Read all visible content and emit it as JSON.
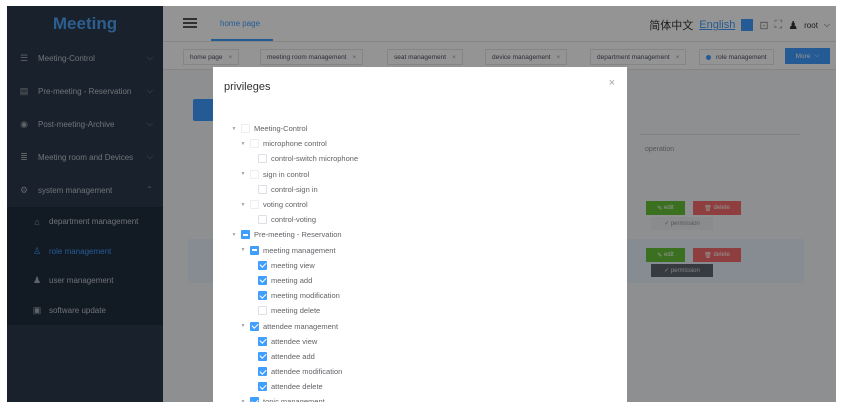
{
  "app": {
    "title": "Meeting",
    "colors": {
      "sidebar_bg": "#2b3a4d",
      "accent": "#409eff",
      "edit_green": "#67c23a",
      "delete_red": "#f56c6c"
    }
  },
  "sidebar": {
    "items": [
      {
        "label": "Meeting-Control",
        "icon": "sliders-icon",
        "expanded": false
      },
      {
        "label": "Pre-meeting - Reservation",
        "icon": "calendar-icon",
        "expanded": false
      },
      {
        "label": "Post-meeting-Archive",
        "icon": "archive-icon",
        "expanded": false
      },
      {
        "label": "Meeting room and Devices",
        "icon": "database-icon",
        "expanded": false
      },
      {
        "label": "system management",
        "icon": "gear-icon",
        "expanded": true
      }
    ],
    "subitems": [
      {
        "label": "department management",
        "icon": "building-icon",
        "active": false
      },
      {
        "label": "role management",
        "icon": "role-icon",
        "active": true
      },
      {
        "label": "user management",
        "icon": "user-icon",
        "active": false
      },
      {
        "label": "software update",
        "icon": "update-icon",
        "active": false
      }
    ]
  },
  "header": {
    "breadcrumb": "home page",
    "lang_cn": "简体中文",
    "lang_en": "English",
    "user": "root"
  },
  "tabs": {
    "items": [
      {
        "label": "home page"
      },
      {
        "label": "meeting room management"
      },
      {
        "label": "seat management"
      },
      {
        "label": "device management"
      },
      {
        "label": "department management"
      },
      {
        "label": "role management"
      }
    ],
    "more": "More"
  },
  "table": {
    "operation_header": "operation",
    "edit": "edit",
    "delete": "delete",
    "permission": "permission"
  },
  "dialog": {
    "title": "privileges",
    "close": "×",
    "tree": [
      {
        "label": "Meeting-Control",
        "level": 0,
        "arrow": true,
        "state": "unchecked"
      },
      {
        "label": "microphone control",
        "level": 1,
        "arrow": true,
        "state": "unchecked"
      },
      {
        "label": "control-switch microphone",
        "level": 2,
        "arrow": false,
        "state": "unchecked"
      },
      {
        "label": "sign in control",
        "level": 1,
        "arrow": true,
        "state": "unchecked"
      },
      {
        "label": "control-sign in",
        "level": 2,
        "arrow": false,
        "state": "unchecked"
      },
      {
        "label": "voting control",
        "level": 1,
        "arrow": true,
        "state": "unchecked"
      },
      {
        "label": "control-voting",
        "level": 2,
        "arrow": false,
        "state": "unchecked"
      },
      {
        "label": "Pre-meeting - Reservation",
        "level": 0,
        "arrow": true,
        "state": "indeterminate"
      },
      {
        "label": "meeting management",
        "level": 1,
        "arrow": true,
        "state": "indeterminate"
      },
      {
        "label": "meeting view",
        "level": 2,
        "arrow": false,
        "state": "checked"
      },
      {
        "label": "meeting add",
        "level": 2,
        "arrow": false,
        "state": "checked"
      },
      {
        "label": "meeting modification",
        "level": 2,
        "arrow": false,
        "state": "checked"
      },
      {
        "label": "meeting delete",
        "level": 2,
        "arrow": false,
        "state": "unchecked"
      },
      {
        "label": "attendee management",
        "level": 1,
        "arrow": true,
        "state": "checked"
      },
      {
        "label": "attendee view",
        "level": 2,
        "arrow": false,
        "state": "checked"
      },
      {
        "label": "attendee add",
        "level": 2,
        "arrow": false,
        "state": "checked"
      },
      {
        "label": "attendee modification",
        "level": 2,
        "arrow": false,
        "state": "checked"
      },
      {
        "label": "attendee delete",
        "level": 2,
        "arrow": false,
        "state": "checked"
      },
      {
        "label": "topic management",
        "level": 1,
        "arrow": true,
        "state": "checked"
      }
    ]
  }
}
